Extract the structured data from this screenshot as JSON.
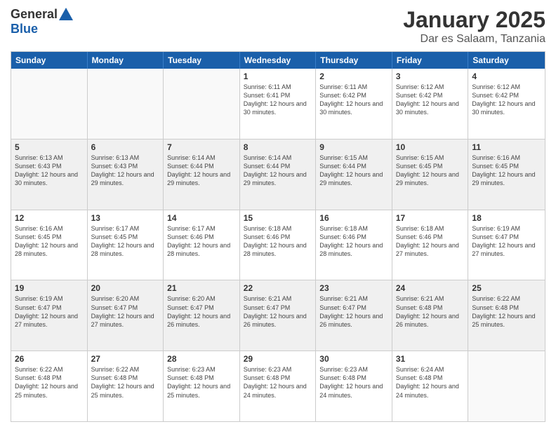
{
  "logo": {
    "general": "General",
    "blue": "Blue"
  },
  "title": "January 2025",
  "subtitle": "Dar es Salaam, Tanzania",
  "header_days": [
    "Sunday",
    "Monday",
    "Tuesday",
    "Wednesday",
    "Thursday",
    "Friday",
    "Saturday"
  ],
  "weeks": [
    [
      {
        "day": "",
        "empty": true
      },
      {
        "day": "",
        "empty": true
      },
      {
        "day": "",
        "empty": true
      },
      {
        "day": "1",
        "sunrise": "6:11 AM",
        "sunset": "6:41 PM",
        "daylight": "12 hours and 30 minutes."
      },
      {
        "day": "2",
        "sunrise": "6:11 AM",
        "sunset": "6:42 PM",
        "daylight": "12 hours and 30 minutes."
      },
      {
        "day": "3",
        "sunrise": "6:12 AM",
        "sunset": "6:42 PM",
        "daylight": "12 hours and 30 minutes."
      },
      {
        "day": "4",
        "sunrise": "6:12 AM",
        "sunset": "6:42 PM",
        "daylight": "12 hours and 30 minutes."
      }
    ],
    [
      {
        "day": "5",
        "sunrise": "6:13 AM",
        "sunset": "6:43 PM",
        "daylight": "12 hours and 30 minutes."
      },
      {
        "day": "6",
        "sunrise": "6:13 AM",
        "sunset": "6:43 PM",
        "daylight": "12 hours and 29 minutes."
      },
      {
        "day": "7",
        "sunrise": "6:14 AM",
        "sunset": "6:44 PM",
        "daylight": "12 hours and 29 minutes."
      },
      {
        "day": "8",
        "sunrise": "6:14 AM",
        "sunset": "6:44 PM",
        "daylight": "12 hours and 29 minutes."
      },
      {
        "day": "9",
        "sunrise": "6:15 AM",
        "sunset": "6:44 PM",
        "daylight": "12 hours and 29 minutes."
      },
      {
        "day": "10",
        "sunrise": "6:15 AM",
        "sunset": "6:45 PM",
        "daylight": "12 hours and 29 minutes."
      },
      {
        "day": "11",
        "sunrise": "6:16 AM",
        "sunset": "6:45 PM",
        "daylight": "12 hours and 29 minutes."
      }
    ],
    [
      {
        "day": "12",
        "sunrise": "6:16 AM",
        "sunset": "6:45 PM",
        "daylight": "12 hours and 28 minutes."
      },
      {
        "day": "13",
        "sunrise": "6:17 AM",
        "sunset": "6:45 PM",
        "daylight": "12 hours and 28 minutes."
      },
      {
        "day": "14",
        "sunrise": "6:17 AM",
        "sunset": "6:46 PM",
        "daylight": "12 hours and 28 minutes."
      },
      {
        "day": "15",
        "sunrise": "6:18 AM",
        "sunset": "6:46 PM",
        "daylight": "12 hours and 28 minutes."
      },
      {
        "day": "16",
        "sunrise": "6:18 AM",
        "sunset": "6:46 PM",
        "daylight": "12 hours and 28 minutes."
      },
      {
        "day": "17",
        "sunrise": "6:18 AM",
        "sunset": "6:46 PM",
        "daylight": "12 hours and 27 minutes."
      },
      {
        "day": "18",
        "sunrise": "6:19 AM",
        "sunset": "6:47 PM",
        "daylight": "12 hours and 27 minutes."
      }
    ],
    [
      {
        "day": "19",
        "sunrise": "6:19 AM",
        "sunset": "6:47 PM",
        "daylight": "12 hours and 27 minutes."
      },
      {
        "day": "20",
        "sunrise": "6:20 AM",
        "sunset": "6:47 PM",
        "daylight": "12 hours and 27 minutes."
      },
      {
        "day": "21",
        "sunrise": "6:20 AM",
        "sunset": "6:47 PM",
        "daylight": "12 hours and 26 minutes."
      },
      {
        "day": "22",
        "sunrise": "6:21 AM",
        "sunset": "6:47 PM",
        "daylight": "12 hours and 26 minutes."
      },
      {
        "day": "23",
        "sunrise": "6:21 AM",
        "sunset": "6:47 PM",
        "daylight": "12 hours and 26 minutes."
      },
      {
        "day": "24",
        "sunrise": "6:21 AM",
        "sunset": "6:48 PM",
        "daylight": "12 hours and 26 minutes."
      },
      {
        "day": "25",
        "sunrise": "6:22 AM",
        "sunset": "6:48 PM",
        "daylight": "12 hours and 25 minutes."
      }
    ],
    [
      {
        "day": "26",
        "sunrise": "6:22 AM",
        "sunset": "6:48 PM",
        "daylight": "12 hours and 25 minutes."
      },
      {
        "day": "27",
        "sunrise": "6:22 AM",
        "sunset": "6:48 PM",
        "daylight": "12 hours and 25 minutes."
      },
      {
        "day": "28",
        "sunrise": "6:23 AM",
        "sunset": "6:48 PM",
        "daylight": "12 hours and 25 minutes."
      },
      {
        "day": "29",
        "sunrise": "6:23 AM",
        "sunset": "6:48 PM",
        "daylight": "12 hours and 24 minutes."
      },
      {
        "day": "30",
        "sunrise": "6:23 AM",
        "sunset": "6:48 PM",
        "daylight": "12 hours and 24 minutes."
      },
      {
        "day": "31",
        "sunrise": "6:24 AM",
        "sunset": "6:48 PM",
        "daylight": "12 hours and 24 minutes."
      },
      {
        "day": "",
        "empty": true
      }
    ]
  ],
  "labels": {
    "sunrise": "Sunrise:",
    "sunset": "Sunset:",
    "daylight": "Daylight:"
  }
}
